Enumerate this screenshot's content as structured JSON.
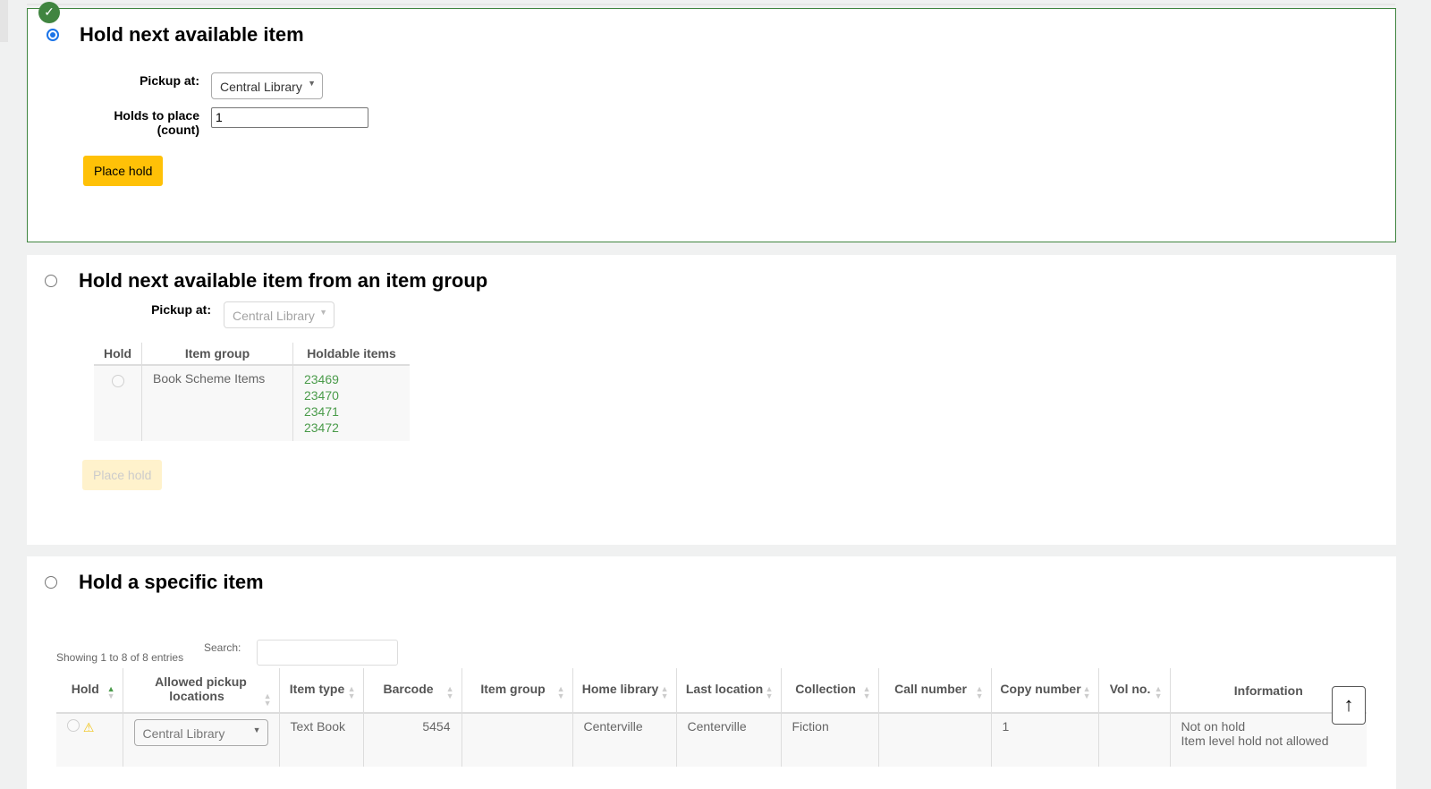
{
  "section1": {
    "title": "Hold next available item",
    "pickup_label": "Pickup at:",
    "pickup_value": "Central Library",
    "count_label_1": "Holds to place",
    "count_label_2": "(count)",
    "count_value": "1",
    "button": "Place hold"
  },
  "section2": {
    "title": "Hold next available item from an item group",
    "pickup_label": "Pickup at:",
    "pickup_value": "Central Library",
    "headers": [
      "Hold",
      "Item group",
      "Holdable items"
    ],
    "group": "Book Scheme Items",
    "items": [
      "23469",
      "23470",
      "23471",
      "23472"
    ],
    "button": "Place hold"
  },
  "section3": {
    "title": "Hold a specific item",
    "info": "Showing 1 to 8 of 8 entries",
    "search_label": "Search:",
    "search_value": "",
    "headers": [
      "Hold",
      "Allowed pickup locations",
      "Item type",
      "Barcode",
      "Item group",
      "Home library",
      "Last location",
      "Collection",
      "Call number",
      "Copy number",
      "Vol no.",
      "Information"
    ],
    "row": {
      "pickup": "Central Library",
      "item_type": "Text Book",
      "barcode": "5454",
      "item_group": "",
      "home": "Centerville",
      "last": "Centerville",
      "collection": "Fiction",
      "call_number": "",
      "copy": "1",
      "vol": "",
      "info1": "Not on hold",
      "info2": "Item level hold not allowed"
    }
  },
  "colors": {
    "accent": "#ffc107",
    "success": "#408540",
    "link": "#4a9b4a"
  }
}
